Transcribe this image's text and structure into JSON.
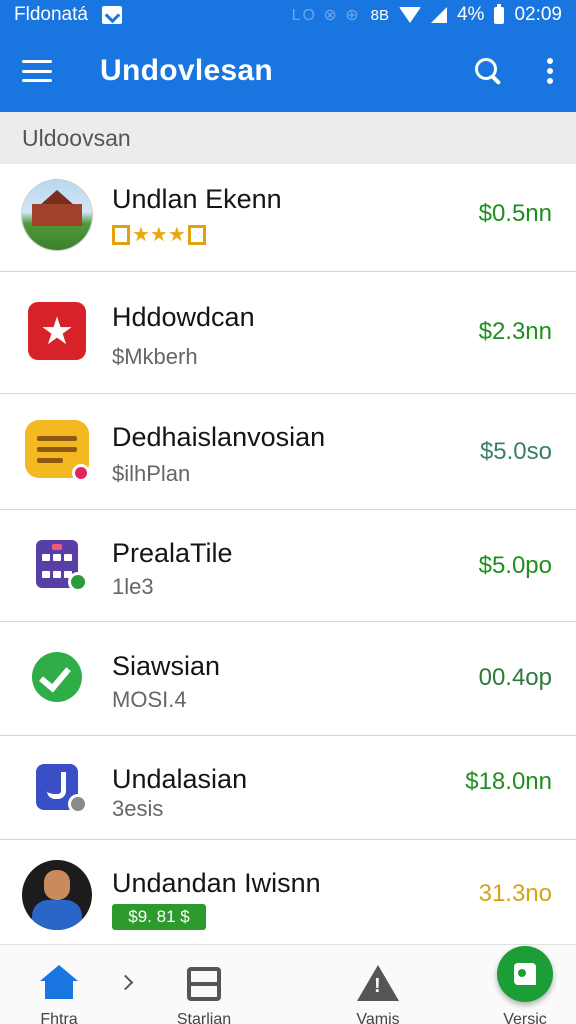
{
  "status_bar": {
    "carrier": "Fldonatá",
    "clock": "02:09",
    "battery": "4%",
    "misc": "LO ⊗ ⊕",
    "extra": "8B"
  },
  "app_bar": {
    "title": "Undovlesan"
  },
  "section": {
    "header": "Uldoovsan"
  },
  "rows": [
    {
      "name": "Undlan Ekenn",
      "price": "$0.5nn"
    },
    {
      "name": "Hddowdcan",
      "sub": "$Mkberh",
      "price": "$2.3nn"
    },
    {
      "name": "Dedhaislanvosian",
      "sub": "$ilhPlan",
      "price": "$5.0so"
    },
    {
      "name": "PrealaTile",
      "sub": "1le3",
      "price": "$5.0po"
    },
    {
      "name": "Siawsian",
      "sub": "MOSI.4",
      "price": "00.4op"
    },
    {
      "name": "Undalasian",
      "sub": "3esis",
      "price": "$18.0nn"
    },
    {
      "name": "Undandan Iwisnn",
      "badge": "$9. 81 $",
      "price": "31.3no"
    }
  ],
  "bottom_nav": {
    "home": "Fhtra",
    "swap": "Starlian",
    "warn": "Vamis",
    "fab": "Versic"
  },
  "colors": {
    "primary": "#1976e0",
    "price_green": "#1f8f1f",
    "price_gold": "#d4a514",
    "fab": "#1a9e35"
  },
  "icons": [
    "menu-icon",
    "search-icon",
    "more-vert-icon",
    "house-photo-icon",
    "star-app-icon",
    "notes-icon",
    "calendar-icon",
    "check-circle-icon",
    "doc-app-icon",
    "avatar",
    "home-icon",
    "swap-icon",
    "warning-icon",
    "fab-icon"
  ]
}
